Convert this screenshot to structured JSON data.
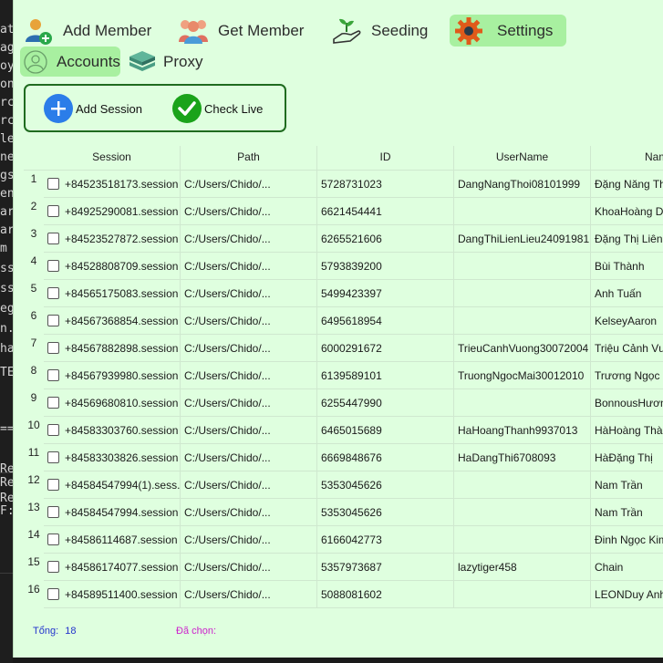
{
  "background_fragments": [
    "at",
    "ag",
    "oy",
    "on",
    "rc",
    "rc",
    "le",
    "ne",
    "gs",
    "en",
    "ar",
    "ar",
    "m",
    "ss",
    "ss",
    "eg",
    "n.p",
    "ha",
    "TEF",
    "==",
    "Re",
    "Re",
    "Re",
    "F:"
  ],
  "nav": {
    "tabs": [
      {
        "label": "Add Member",
        "icon": "add-member-icon",
        "active": false
      },
      {
        "label": "Get Member",
        "icon": "group-icon",
        "active": false
      },
      {
        "label": "Seeding",
        "icon": "seedling-hand-icon",
        "active": false
      },
      {
        "label": "Settings",
        "icon": "gear-icon",
        "active": true
      }
    ],
    "subtabs": [
      {
        "label": "Accounts",
        "icon": "user-circle-icon",
        "active": true
      },
      {
        "label": "Proxy",
        "icon": "server-stack-icon",
        "active": false
      }
    ]
  },
  "actions": {
    "add_session": "Add Session",
    "check_live": "Check Live"
  },
  "table": {
    "columns": [
      "Session",
      "Path",
      "ID",
      "UserName",
      "Name"
    ],
    "rows": [
      {
        "n": "1",
        "session": "+84523518173.session",
        "path": "C:/Users/Chido/...",
        "id": "5728731023",
        "username": "DangNangThoi08101999",
        "name": "Đặng Năng Thoi"
      },
      {
        "n": "2",
        "session": "+84925290081.session",
        "path": "C:/Users/Chido/...",
        "id": "6621454441",
        "username": "",
        "name": "KhoaHoàng Dung"
      },
      {
        "n": "3",
        "session": "+84523527872.session",
        "path": "C:/Users/Chido/...",
        "id": "6265521606",
        "username": "DangThiLienLieu24091981",
        "name": "Đặng Thị Liên"
      },
      {
        "n": "4",
        "session": "+84528808709.session",
        "path": "C:/Users/Chido/...",
        "id": "5793839200",
        "username": "",
        "name": "Bùi Thành"
      },
      {
        "n": "5",
        "session": "+84565175083.session",
        "path": "C:/Users/Chido/...",
        "id": "5499423397",
        "username": "",
        "name": "Anh Tuấn"
      },
      {
        "n": "6",
        "session": "+84567368854.session",
        "path": "C:/Users/Chido/...",
        "id": "6495618954",
        "username": "",
        "name": "KelseyAaron"
      },
      {
        "n": "7",
        "session": "+84567882898.session",
        "path": "C:/Users/Chido/...",
        "id": "6000291672",
        "username": "TrieuCanhVuong30072004",
        "name": "Triệu Cảnh Vương"
      },
      {
        "n": "8",
        "session": "+84567939980.session",
        "path": "C:/Users/Chido/...",
        "id": "6139589101",
        "username": "TruongNgocMai30012010",
        "name": "Trương Ngọc Mai"
      },
      {
        "n": "9",
        "session": "+84569680810.session",
        "path": "C:/Users/Chido/...",
        "id": "6255447990",
        "username": "",
        "name": "BonnousHương"
      },
      {
        "n": "10",
        "session": "+84583303760.session",
        "path": "C:/Users/Chido/...",
        "id": "6465015689",
        "username": "HaHoangThanh9937013",
        "name": "HàHoàng Thành"
      },
      {
        "n": "11",
        "session": "+84583303826.session",
        "path": "C:/Users/Chido/...",
        "id": "6669848676",
        "username": "HaDangThi6708093",
        "name": "HàĐặng Thị"
      },
      {
        "n": "12",
        "session": "+84584547994(1).sess...",
        "path": "C:/Users/Chido/...",
        "id": "5353045626",
        "username": "",
        "name": "Nam Trần"
      },
      {
        "n": "13",
        "session": "+84584547994.session",
        "path": "C:/Users/Chido/...",
        "id": "5353045626",
        "username": "",
        "name": "Nam Trần"
      },
      {
        "n": "14",
        "session": "+84586114687.session",
        "path": "C:/Users/Chido/...",
        "id": "6166042773",
        "username": "",
        "name": "Đinh Ngọc Kim"
      },
      {
        "n": "15",
        "session": "+84586174077.session",
        "path": "C:/Users/Chido/...",
        "id": "5357973687",
        "username": "lazytiger458",
        "name": "Chain"
      },
      {
        "n": "16",
        "session": "+84589511400.session",
        "path": "C:/Users/Chido/...",
        "id": "5088081602",
        "username": "",
        "name": "LEONDuy Anh"
      }
    ]
  },
  "status": {
    "total_label": "Tổng:",
    "total_value": "18",
    "selected_label": "Đã chọn:"
  },
  "colors": {
    "window_bg": "#dfffdf",
    "active_tab": "#a8f0a0",
    "group_border": "#1f6b1f",
    "add_button": "#2b7de9",
    "check_button": "#1aa31a",
    "total_text": "#2233cc",
    "selected_text": "#cc22cc"
  }
}
